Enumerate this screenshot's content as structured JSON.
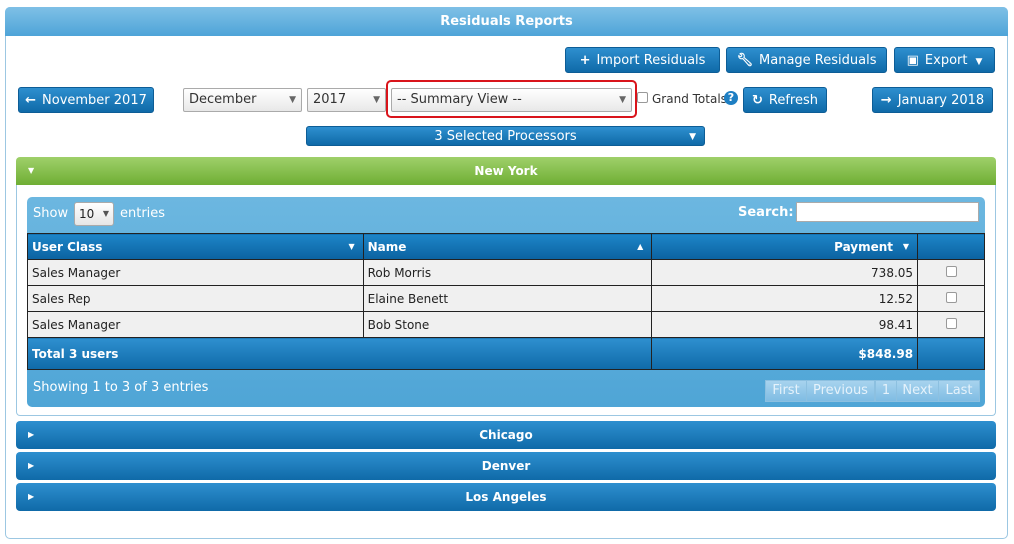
{
  "header": {
    "title": "Residuals Reports"
  },
  "toolbar": {
    "import_label": "Import Residuals",
    "manage_label": "Manage Residuals",
    "export_label": "Export"
  },
  "nav": {
    "prev_label": "November 2017",
    "next_label": "January 2018",
    "month_value": "December",
    "year_value": "2017",
    "view_value": "-- Summary View --",
    "grand_totals_label": "Grand Totals",
    "refresh_label": "Refresh",
    "processors_label": "3 Selected Processors"
  },
  "sections": {
    "active": "New York",
    "collapsed": [
      "Chicago",
      "Denver",
      "Los Angeles"
    ]
  },
  "table": {
    "show_label": "Show",
    "entries_value": "10",
    "entries_label": "entries",
    "search_label": "Search:",
    "columns": [
      "User Class",
      "Name",
      "Payment"
    ],
    "rows": [
      {
        "user_class": "Sales Manager",
        "name": "Rob Morris",
        "payment": "738.05"
      },
      {
        "user_class": "Sales Rep",
        "name": "Elaine Benett",
        "payment": "12.52"
      },
      {
        "user_class": "Sales Manager",
        "name": "Bob Stone",
        "payment": "98.41"
      }
    ],
    "total_label": "Total 3 users",
    "total_value": "$848.98",
    "info": "Showing 1 to 3 of 3 entries",
    "pager": {
      "first": "First",
      "previous": "Previous",
      "page": "1",
      "next": "Next",
      "last": "Last"
    }
  }
}
